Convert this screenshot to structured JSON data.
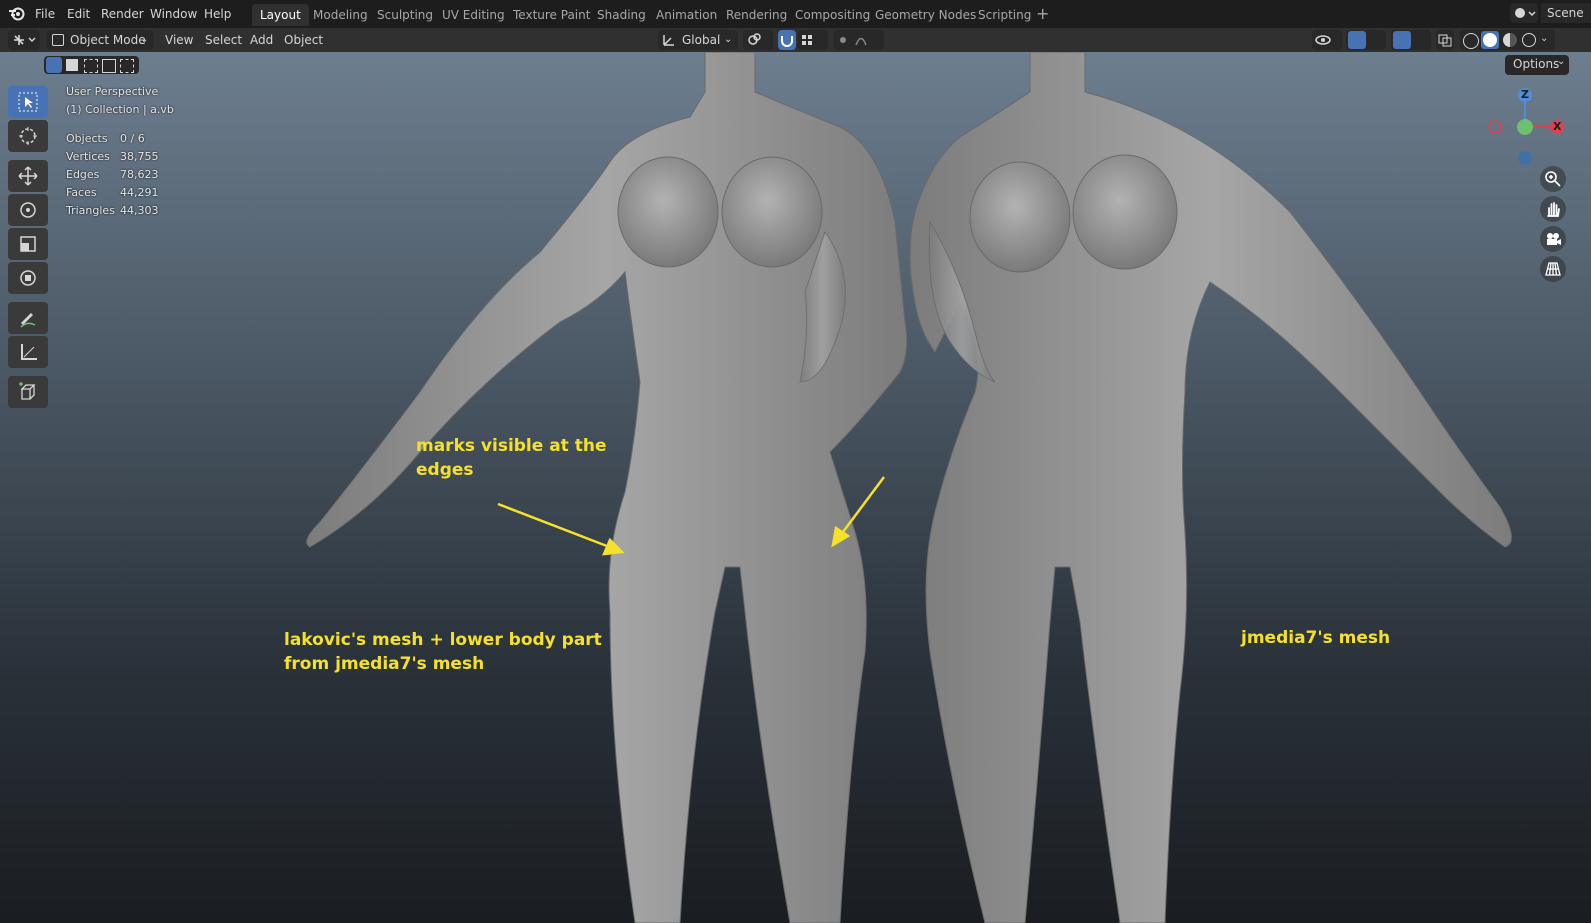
{
  "menu": {
    "file": "File",
    "edit": "Edit",
    "render": "Render",
    "window": "Window",
    "help": "Help"
  },
  "workspace_tabs": [
    "Layout",
    "Modeling",
    "Sculpting",
    "UV Editing",
    "Texture Paint",
    "Shading",
    "Animation",
    "Rendering",
    "Compositing",
    "Geometry Nodes",
    "Scripting"
  ],
  "active_tab": "Layout",
  "scene_label": "Scene",
  "header": {
    "mode": "Object Mode",
    "view": "View",
    "select": "Select",
    "add": "Add",
    "object": "Object",
    "transform_orientation": "Global",
    "options": "Options"
  },
  "overlay": {
    "perspective": "User Perspective",
    "collection": "(1) Collection | a.vb",
    "stats": [
      {
        "label": "Objects",
        "value": "0 / 6"
      },
      {
        "label": "Vertices",
        "value": "38,755"
      },
      {
        "label": "Edges",
        "value": "78,623"
      },
      {
        "label": "Faces",
        "value": "44,291"
      },
      {
        "label": "Triangles",
        "value": "44,303"
      }
    ]
  },
  "gizmo": {
    "z": "Z",
    "x": "X"
  },
  "annotations": {
    "marks": [
      "marks visible at the",
      "edges"
    ],
    "left_mesh": [
      "lakovic's mesh + lower body part",
      "from jmedia7's mesh"
    ],
    "right_mesh": "jmedia7's mesh"
  },
  "colors": {
    "annotation": "#f5e12a",
    "accent": "#4772b3",
    "body": "#9b9b9b"
  }
}
